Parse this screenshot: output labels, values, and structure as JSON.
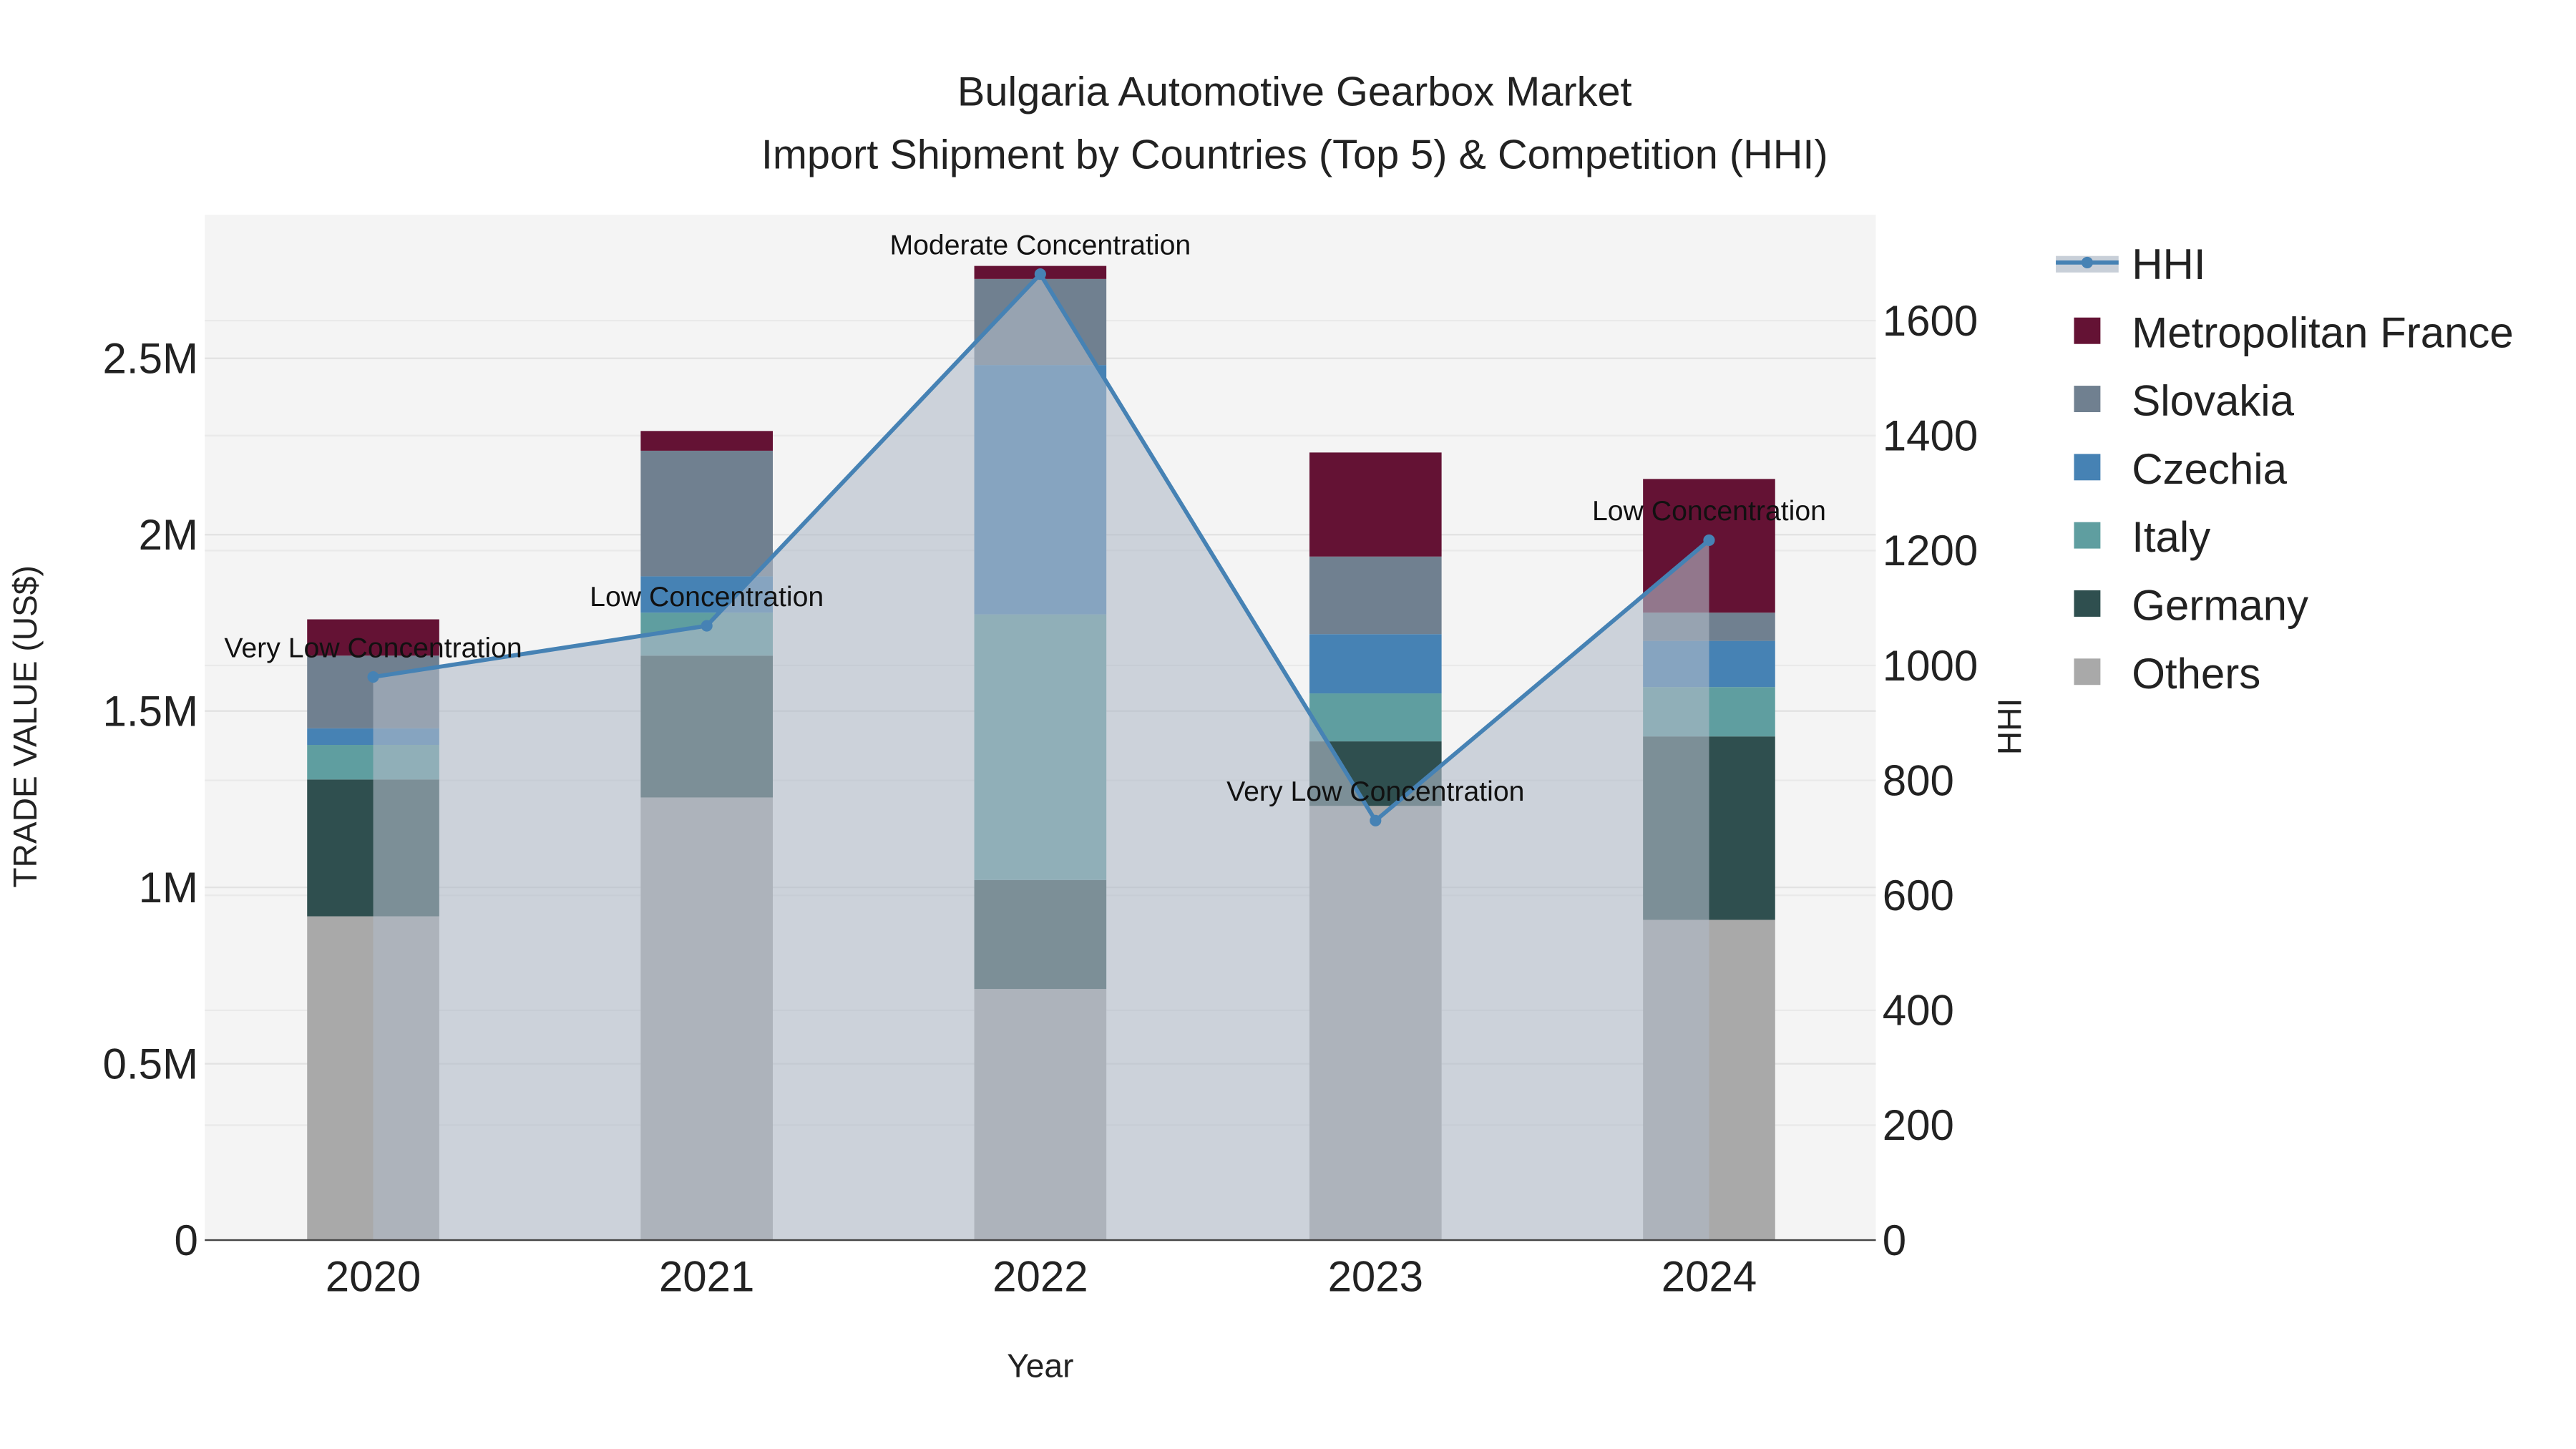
{
  "chart_data": {
    "type": "bar",
    "stacked": true,
    "title": "Bulgaria Automotive Gearbox Market",
    "subtitle": "Import Shipment by Countries (Top 5) & Competition (HHI)",
    "xlabel": "Year",
    "ylabel": "TRADE VALUE (US$)",
    "y2label": "HHI",
    "categories": [
      "2020",
      "2021",
      "2022",
      "2023",
      "2024"
    ],
    "ylim": [
      0,
      2900000
    ],
    "y2lim": [
      0,
      1780
    ],
    "yticks": [
      0,
      500000,
      1000000,
      1500000,
      2000000,
      2500000
    ],
    "ytick_labels": [
      "0",
      "0.5M",
      "1M",
      "1.5M",
      "2M",
      "2.5M"
    ],
    "y2ticks": [
      0,
      200,
      400,
      600,
      800,
      1000,
      1200,
      1400,
      1600
    ],
    "y2tick_labels": [
      "0",
      "200",
      "400",
      "600",
      "800",
      "1000",
      "1200",
      "1400",
      "1600"
    ],
    "series": [
      {
        "name": "Others",
        "color": "#a9a9a9",
        "values": [
          918000,
          1255000,
          712000,
          1231000,
          908000
        ]
      },
      {
        "name": "Germany",
        "color": "#2f4f4f",
        "values": [
          388000,
          402000,
          309000,
          183000,
          520000
        ]
      },
      {
        "name": "Italy",
        "color": "#5f9ea0",
        "values": [
          98000,
          122000,
          753000,
          136000,
          140000
        ]
      },
      {
        "name": "Czechia",
        "color": "#4682b4",
        "values": [
          47000,
          103000,
          707000,
          168000,
          131000
        ]
      },
      {
        "name": "Slovakia",
        "color": "#708090",
        "values": [
          206000,
          356000,
          244000,
          220000,
          80000
        ]
      },
      {
        "name": "Metropolitan France",
        "color": "#641234",
        "values": [
          103000,
          56000,
          37000,
          295000,
          379000
        ]
      }
    ],
    "line": {
      "name": "HHI",
      "color": "#4682b4",
      "values": [
        980,
        1069,
        1681,
        730,
        1218
      ],
      "annotations": [
        "Very Low Concentration",
        "Low Concentration",
        "Moderate Concentration",
        "Very Low Concentration",
        "Low Concentration"
      ]
    },
    "legend": [
      "HHI",
      "Metropolitan France",
      "Slovakia",
      "Czechia",
      "Italy",
      "Germany",
      "Others"
    ],
    "legend_position": "right",
    "grid": true
  }
}
